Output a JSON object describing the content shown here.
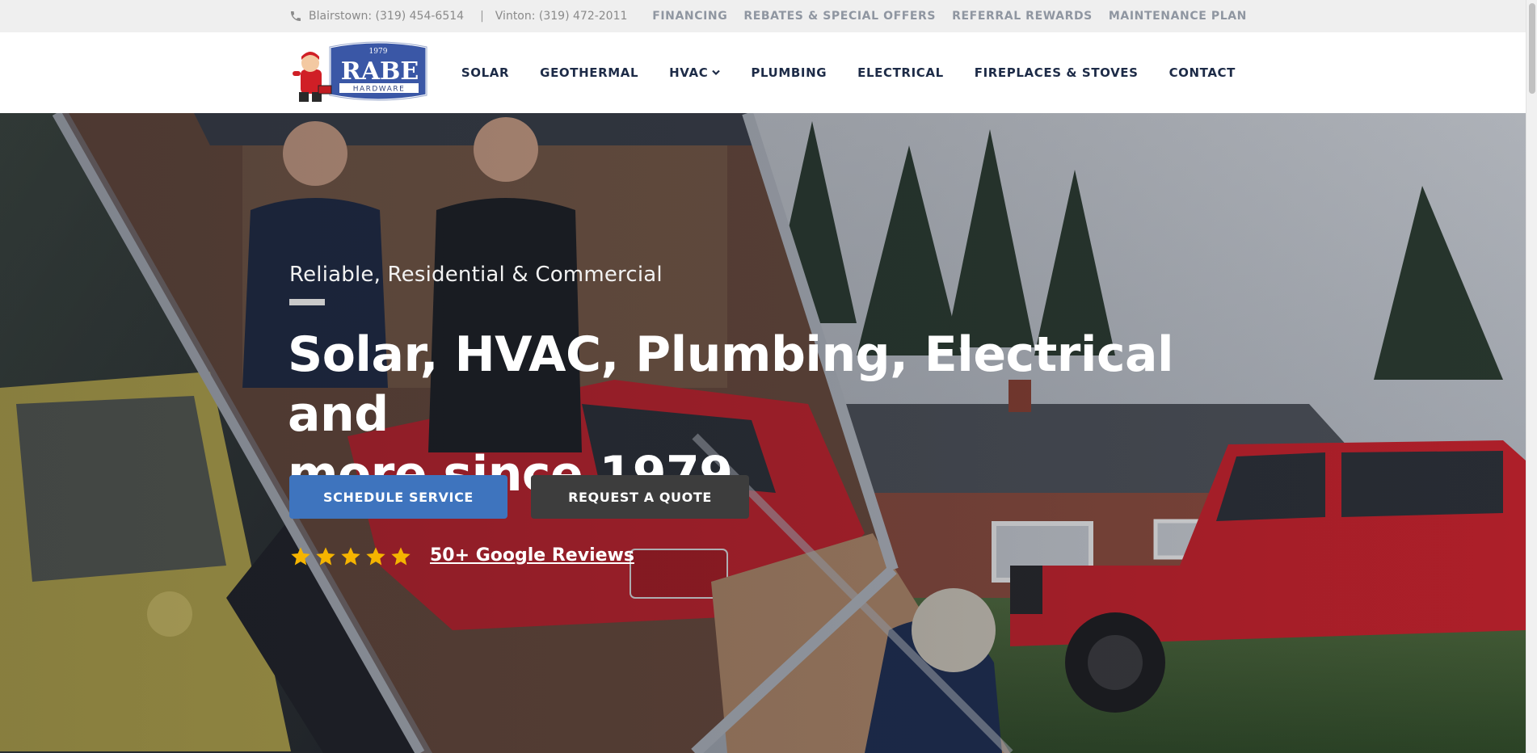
{
  "topbar": {
    "phone_blairstown": "Blairstown: (319) 454-6514",
    "separator": "|",
    "phone_vinton": "Vinton: (319) 472-2011",
    "links": [
      "FINANCING",
      "REBATES & SPECIAL OFFERS",
      "REFERRAL REWARDS",
      "MAINTENANCE PLAN"
    ]
  },
  "logo": {
    "year": "1979",
    "name": "RABE",
    "sub": "HARDWARE"
  },
  "nav": {
    "items": [
      "SOLAR",
      "GEOTHERMAL",
      "HVAC",
      "PLUMBING",
      "ELECTRICAL",
      "FIREPLACES & STOVES",
      "CONTACT"
    ]
  },
  "hero": {
    "eyebrow": "Reliable, Residential & Commercial",
    "headline_line1": "Solar, HVAC, Plumbing, Electrical and",
    "headline_line2": "more since 1979",
    "schedule_label": "SCHEDULE SERVICE",
    "quote_label": "REQUEST A QUOTE",
    "rating_stars": 5,
    "reviews_label": "50+ Google Reviews"
  },
  "colors": {
    "primary_blue": "#3e74be",
    "dark_button": "#3d3d3d",
    "nav_text": "#1d2b47",
    "star": "#f5b400",
    "truck_red": "#c8202a"
  }
}
